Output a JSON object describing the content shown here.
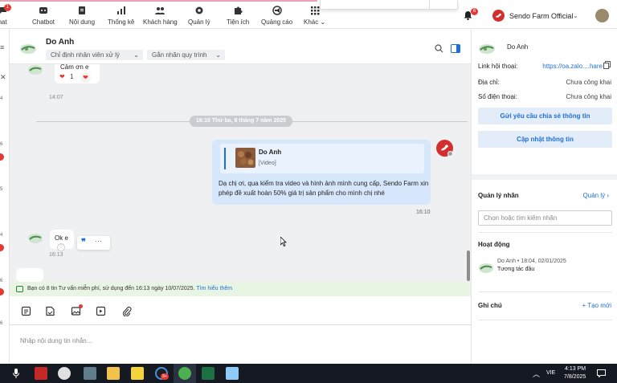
{
  "nav": {
    "items": [
      {
        "label": "hat",
        "icon": "chat-icon"
      },
      {
        "label": "Chatbot",
        "icon": "chatbot-icon"
      },
      {
        "label": "Nội dung",
        "icon": "document-icon"
      },
      {
        "label": "Thống kê",
        "icon": "chart-icon"
      },
      {
        "label": "Khách hàng",
        "icon": "users-icon"
      },
      {
        "label": "Quản lý",
        "icon": "gear-icon"
      },
      {
        "label": "Tiện ích",
        "icon": "puzzle-icon"
      },
      {
        "label": "Quảng cáo",
        "icon": "megaphone-icon"
      },
      {
        "label": "Khác",
        "icon": "grid-icon"
      }
    ],
    "chat_badge": "1",
    "bell_badge": "6",
    "account_name": "Sendo Farm Official"
  },
  "left_sliver": {
    "numbers": [
      "4",
      "6",
      "5",
      "4",
      "6",
      "6"
    ]
  },
  "header": {
    "name": "Do Anh",
    "assign_label": "Chỉ định nhân viên xử lý",
    "tag_label": "Gắn nhãn quy trình"
  },
  "messages": {
    "first_text": "Cảm ơn e",
    "first_reaction_count": "1",
    "first_time": "14:07",
    "date_divider": "16:10 Thứ ba, 8 tháng 7 năm 2025",
    "quote_name": "Do Anh",
    "quote_sub": "[Video]",
    "sent_text": "Dạ chị ơi, qua kiểm tra video và hình ảnh mình cung cấp, Sendo Farm xin phép đề xuất hoàn 50% giá trị sản phẩm cho mình chị nhé",
    "sent_time": "16:10",
    "ok_text": "Ok e",
    "ok_time": "16:13"
  },
  "notice": {
    "text": "Bạn có 8 tin Tư vấn miễn phí, sử dụng đến 16:13 ngày 10/07/2025.",
    "link": "Tìm hiểu thêm"
  },
  "composer": {
    "placeholder": "Nhập nội dung tin nhắn..."
  },
  "right_panel": {
    "name": "Do Anh",
    "link_label": "Link hội thoại:",
    "link_value": "https://oa.zalo....hare",
    "address_label": "Địa chỉ:",
    "address_value": "Chưa công khai",
    "phone_label": "Số điện thoại:",
    "phone_value": "Chưa công khai",
    "share_button": "Gửi yêu cầu chia sẻ thông tin",
    "update_button": "Cập nhật thông tin",
    "tags_title": "Quản lý nhãn",
    "tags_action": "Quản lý",
    "tags_placeholder": "Chọn hoặc tìm kiếm nhãn",
    "activity_title": "Hoạt động",
    "activity_user": "Do Anh",
    "activity_time": "18:04, 02/01/2025",
    "activity_desc": "Tương tác đầu",
    "notes_title": "Ghi chú",
    "notes_action": "+ Tạo mới"
  },
  "taskbar": {
    "lang": "VIE",
    "time": "4:13 PM",
    "date": "7/8/2025",
    "badge": "9+"
  },
  "colors": {
    "accent": "#1e6fd9",
    "brand_red": "#d32f2f",
    "notice_bg": "#e8f5e3",
    "sent_bubble": "#d6e7fb"
  }
}
